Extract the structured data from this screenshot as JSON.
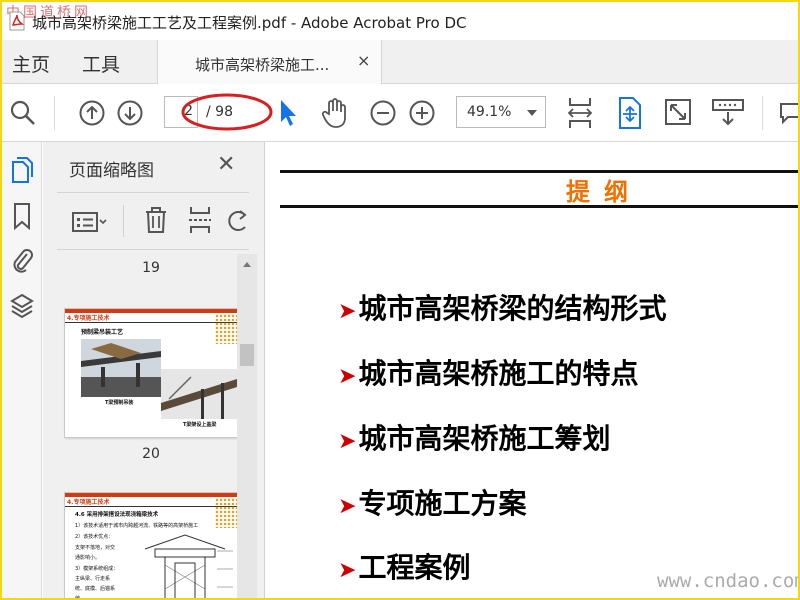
{
  "window": {
    "title": "城市高架桥梁施工工艺及工程案例.pdf - Adobe Acrobat Pro DC",
    "watermark_top": "中国道桥网"
  },
  "tabs": {
    "home": "主页",
    "tools": "工具",
    "document": "城市高架桥梁施工...",
    "close_glyph": "×"
  },
  "toolbar": {
    "page_current": "2",
    "page_total": "/ 98",
    "zoom": "49.1%"
  },
  "thumbnail_panel": {
    "title": "页面缩略图",
    "close_glyph": "✕",
    "pages": [
      {
        "number": "19",
        "header": "4.专项施工技术",
        "caption": "预制梁吊装工艺",
        "image_label_1": "T梁预制吊装",
        "image_label_2": "T梁架设上盖梁"
      },
      {
        "number": "20",
        "header": "4.专项施工技术",
        "subheader": "4.6 采用排架搭设法现浇箱梁技术",
        "lines": [
          "1）该技术适用于城市内跨越河流、铁路等的高架桥施工",
          "2）该技术优点：",
          "支架不落地，对交",
          "通影响小。",
          "3）模架系统组成：",
          "主纵梁、行走系",
          "统、底模、后锚系",
          "统。"
        ]
      }
    ]
  },
  "document_page": {
    "heading": "提纲",
    "bullets": [
      "城市高架桥梁的结构形式",
      "城市高架桥施工的特点",
      "城市高架桥施工筹划",
      "专项施工方案",
      "工程案例"
    ],
    "bullet_glyph": "➤",
    "watermark": "www.cndao.com"
  },
  "colors": {
    "frame_border": "#f5d80a",
    "heading_orange": "#f07000",
    "bullet_red": "#cc0000",
    "select_blue": "#1473e6",
    "annotation_red": "#d81e1e"
  }
}
